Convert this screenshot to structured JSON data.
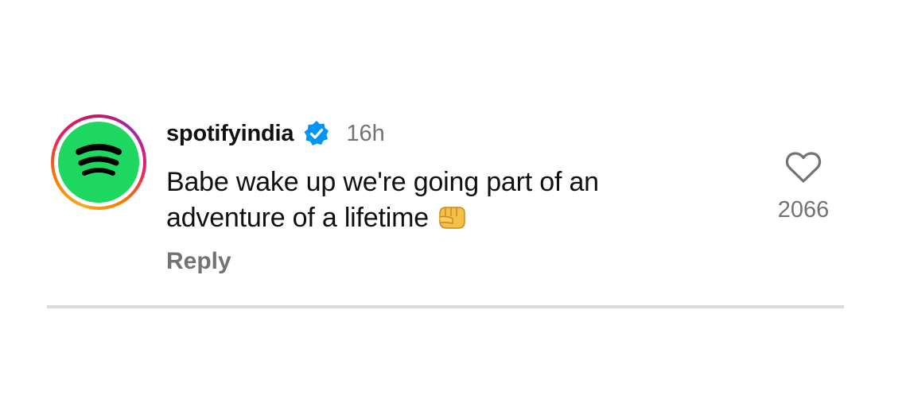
{
  "comment": {
    "avatar_icon": "spotify-logo-icon",
    "username": "spotifyindia",
    "verified_icon": "verified-badge-icon",
    "time": "16h",
    "text": "Babe wake up we're going part of an adventure of a lifetime",
    "emoji_icon": "fist-emoji-icon",
    "reply_label": "Reply",
    "like_icon": "heart-outline-icon",
    "like_count": "2066"
  },
  "colors": {
    "spotify_green": "#1ed760",
    "verified_blue": "#0095f6",
    "secondary_text": "#737373",
    "divider": "#dbdbdb"
  }
}
